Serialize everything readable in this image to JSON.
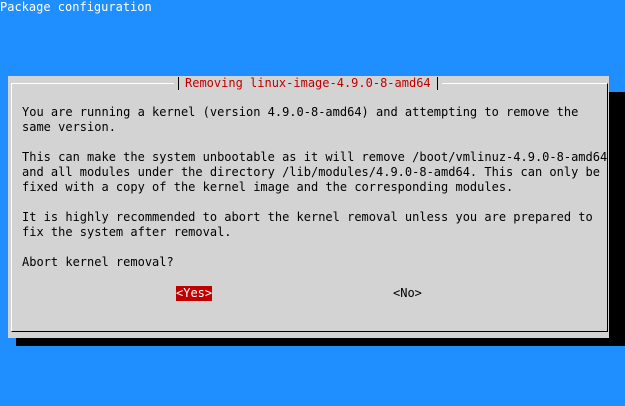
{
  "window": {
    "title": "Package configuration"
  },
  "dialog": {
    "title": "Removing linux-image-4.9.0-8-amd64",
    "body_lines": [
      "You are running a kernel (version 4.9.0-8-amd64) and attempting to remove the",
      "same version.",
      "",
      "This can make the system unbootable as it will remove /boot/vmlinuz-4.9.0-8-amd64",
      "and all modules under the directory /lib/modules/4.9.0-8-amd64. This can only be",
      "fixed with a copy of the kernel image and the corresponding modules.",
      "",
      "It is highly recommended to abort the kernel removal unless you are prepared to",
      "fix the system after removal.",
      "",
      "Abort kernel removal?"
    ],
    "buttons": {
      "yes": "<Yes>",
      "no": "<No>"
    }
  },
  "colors": {
    "background": "#1f8fff",
    "dialog": "#d3d3d3",
    "accent": "#c00000",
    "shadow": "#000000"
  }
}
